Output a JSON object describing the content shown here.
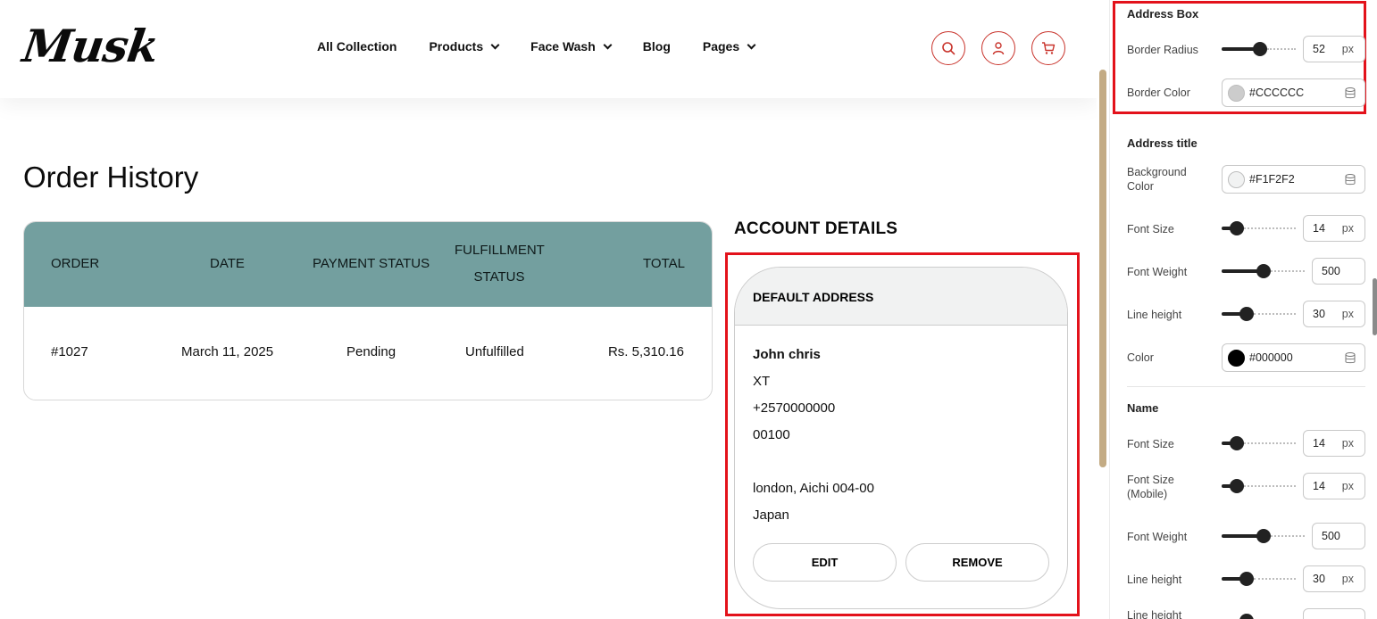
{
  "header": {
    "logo": "Musk",
    "nav": [
      {
        "label": "All Collection",
        "has_dropdown": false
      },
      {
        "label": "Products",
        "has_dropdown": true
      },
      {
        "label": "Face Wash",
        "has_dropdown": true
      },
      {
        "label": "Blog",
        "has_dropdown": false
      },
      {
        "label": "Pages",
        "has_dropdown": true
      }
    ],
    "icons": [
      "search-icon",
      "user-icon",
      "cart-icon"
    ],
    "icon_color": "#c9342c"
  },
  "page": {
    "title": "Order History"
  },
  "orders": {
    "header_color": "#739f9f",
    "columns": [
      "ORDER",
      "DATE",
      "PAYMENT STATUS",
      "FULFILLMENT",
      "STATUS",
      "TOTAL"
    ],
    "rows": [
      {
        "order": "#1027",
        "date": "March 11, 2025",
        "payment": "Pending",
        "fulfillment": "Unfulfilled",
        "total": "Rs. 5,310.16"
      }
    ]
  },
  "account": {
    "title": "ACCOUNT DETAILS",
    "address_title": "DEFAULT ADDRESS",
    "name": "John chris",
    "lines": [
      "XT",
      "+2570000000",
      "00100",
      "london, Aichi 004-00",
      "Japan"
    ],
    "edit_label": "EDIT",
    "remove_label": "REMOVE"
  },
  "panel": {
    "address_box": {
      "title": "Address Box",
      "border_radius_label": "Border Radius",
      "border_radius_value": "52",
      "border_radius_fraction": 0.52,
      "border_color_label": "Border Color",
      "border_color_value": "#CCCCCC"
    },
    "address_title": {
      "title": "Address title",
      "bg_label": "Background Color",
      "bg_value": "#F1F2F2",
      "font_size_label": "Font Size",
      "font_size_value": "14",
      "font_size_fraction": 0.14,
      "font_weight_label": "Font Weight",
      "font_weight_value": "500",
      "font_weight_fraction": 0.5,
      "line_height_label": "Line height",
      "line_height_value": "30",
      "line_height_fraction": 0.3,
      "color_label": "Color",
      "color_value": "#000000"
    },
    "name": {
      "title": "Name",
      "font_size_label": "Font Size",
      "font_size_value": "14",
      "font_size_fraction": 0.14,
      "font_size_mobile_label": "Font Size (Mobile)",
      "font_size_mobile_value": "14",
      "font_size_mobile_fraction": 0.14,
      "font_weight_label": "Font Weight",
      "font_weight_value": "500",
      "font_weight_fraction": 0.5,
      "line_height_label": "Line height",
      "line_height_value": "30",
      "line_height_fraction": 0.3,
      "line_height_2_label": "Line height"
    },
    "unit": "px"
  }
}
